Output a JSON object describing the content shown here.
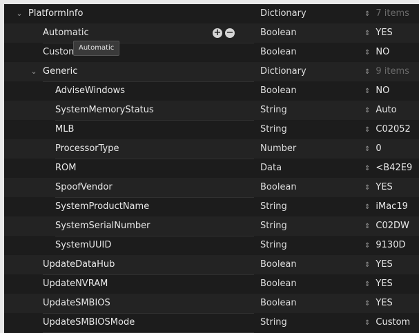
{
  "rows": [
    {
      "key": "PlatformInfo",
      "type": "Dictionary",
      "value": "7 items",
      "expanded": true
    },
    {
      "key": "Automatic",
      "type": "Boolean",
      "value": "YES"
    },
    {
      "key": "Custom",
      "type": "Boolean",
      "value": "NO"
    },
    {
      "key": "Generic",
      "type": "Dictionary",
      "value": "9 items",
      "expanded": true
    },
    {
      "key": "AdviseWindows",
      "type": "Boolean",
      "value": "NO"
    },
    {
      "key": "SystemMemoryStatus",
      "type": "String",
      "value": "Auto"
    },
    {
      "key": "MLB",
      "type": "String",
      "value": "C02052"
    },
    {
      "key": "ProcessorType",
      "type": "Number",
      "value": "0"
    },
    {
      "key": "ROM",
      "type": "Data",
      "value": "<B42E9"
    },
    {
      "key": "SpoofVendor",
      "type": "Boolean",
      "value": "YES"
    },
    {
      "key": "SystemProductName",
      "type": "String",
      "value": "iMac19"
    },
    {
      "key": "SystemSerialNumber",
      "type": "String",
      "value": "C02DW"
    },
    {
      "key": "SystemUUID",
      "type": "String",
      "value": "9130D"
    },
    {
      "key": "UpdateDataHub",
      "type": "Boolean",
      "value": "YES"
    },
    {
      "key": "UpdateNVRAM",
      "type": "Boolean",
      "value": "YES"
    },
    {
      "key": "UpdateSMBIOS",
      "type": "Boolean",
      "value": "YES"
    },
    {
      "key": "UpdateSMBIOSMode",
      "type": "String",
      "value": "Custom"
    }
  ],
  "tooltip": "Automatic",
  "icons": {
    "disclosure": "chevron-down-icon",
    "add": "plus-circle-icon",
    "remove": "minus-circle-icon",
    "stepper": "up-down-arrows-icon"
  },
  "colors": {
    "background": "#1c1c1c",
    "alt_row": "#232323",
    "text": "#e8e8e8",
    "dim_text": "#6a6a6a"
  }
}
